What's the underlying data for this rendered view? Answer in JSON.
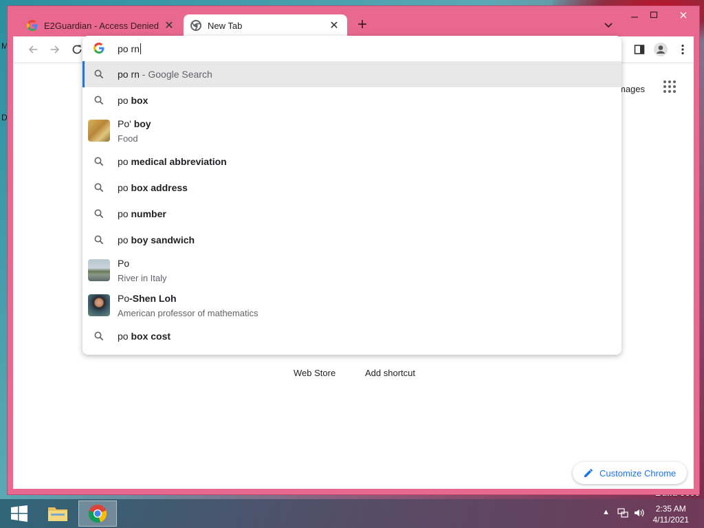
{
  "desktop": {
    "left_marks": [
      "M",
      "D"
    ],
    "build_text": "Build 9600"
  },
  "tabs": [
    {
      "title": "E2Guardian - Access Denied",
      "favicon": "google-icon",
      "active": false
    },
    {
      "title": "New Tab",
      "favicon": "chrome-icon",
      "active": true
    }
  ],
  "omnibox": {
    "query": "po rn",
    "suggestions": [
      {
        "type": "search",
        "prefix": "po rn",
        "bold": "",
        "suffix": " - Google Search",
        "selected": true
      },
      {
        "type": "search",
        "prefix": "po ",
        "bold": "box"
      },
      {
        "type": "entity",
        "prefix": "Po' ",
        "bold": "boy",
        "subtitle": "Food",
        "thumb": "food-thumbnail"
      },
      {
        "type": "search",
        "prefix": "po ",
        "bold": "medical abbreviation"
      },
      {
        "type": "search",
        "prefix": "po ",
        "bold": "box address"
      },
      {
        "type": "search",
        "prefix": "po ",
        "bold": "number"
      },
      {
        "type": "search",
        "prefix": "po ",
        "bold": "boy sandwich"
      },
      {
        "type": "entity",
        "prefix": "Po",
        "bold": "",
        "subtitle": "River in Italy",
        "thumb": "river-thumbnail"
      },
      {
        "type": "entity",
        "prefix": "Po",
        "bold": "-Shen Loh",
        "subtitle": "American professor of mathematics",
        "thumb": "person-thumbnail"
      },
      {
        "type": "search",
        "prefix": "po ",
        "bold": "box cost"
      }
    ]
  },
  "ntp": {
    "images_link": "mages",
    "shortcuts": [
      "Web Store",
      "Add shortcut"
    ],
    "customize_label": "Customize Chrome"
  },
  "taskbar": {
    "time": "2:35 AM",
    "date": "4/11/2021"
  },
  "colors": {
    "frame": "#e8688f",
    "accent": "#1a73e8"
  }
}
